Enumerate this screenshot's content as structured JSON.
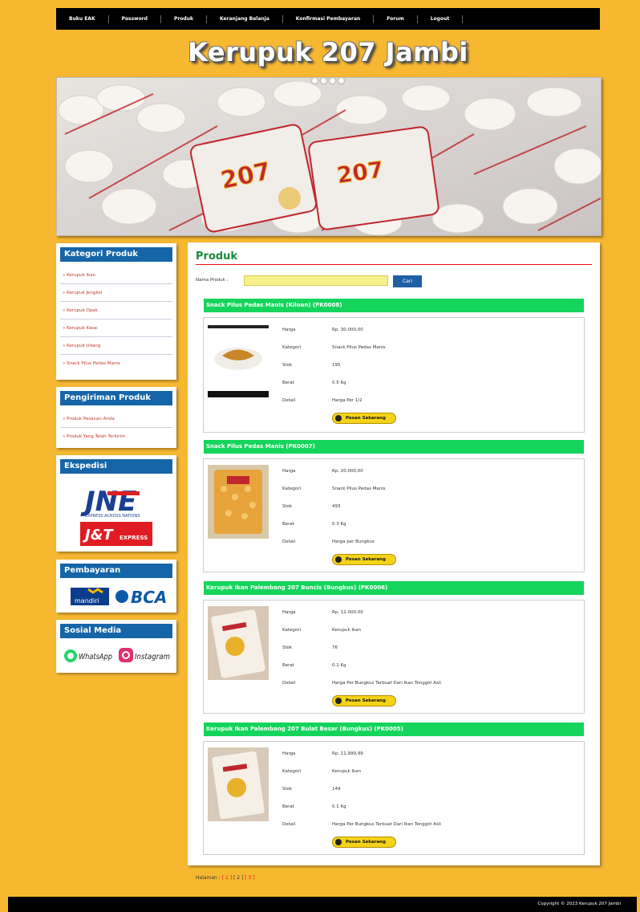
{
  "nav": [
    "Buku EAK",
    "Password",
    "Produk",
    "Keranjang Belanja",
    "Konfirmasi Pembayaran",
    "Forum",
    "Logout"
  ],
  "site_title": "Kerupuk 207 Jambi",
  "sidebar": {
    "categories_title": "Kategori Produk",
    "categories": [
      "» Kerupuk Ikan",
      "» Kerupuk Jengkol",
      "» Kerupuk Opak",
      "» Kerupuk Kwac",
      "» Kerupuk Udang",
      "» Snack Pilus Pedas Manis"
    ],
    "shipping_title": "Pengiriman Produk",
    "shipping": [
      "» Produk Pesanan Anda",
      "» Produk Yang Telah Terkirim"
    ],
    "expedition_title": "Ekspedisi",
    "payment_title": "Pembayaran",
    "social_title": "Sosial Media",
    "logos": {
      "jne": "JNE",
      "jne_sub": "EXPRESS ACROSS NATIONS",
      "jnt": "J&T",
      "jnt_sub": "EXPRESS",
      "mandiri": "mandiri",
      "bca": "BCA",
      "whatsapp": "WhatsApp",
      "instagram": "Instagram"
    }
  },
  "main": {
    "title": "Produk",
    "search_label": "Nama Produk :",
    "search_value": "",
    "search_button": "Cari",
    "spec_labels": {
      "price": "Harga",
      "category": "Kategori",
      "stock": "Stok",
      "weight": "Berat",
      "detail": "Detail"
    },
    "order_label": "Pesan Sekarang",
    "products": [
      {
        "name": "Snack Pilus Pedas Manis (Kiloan) (PK0008)",
        "price": "Rp. 30.000,00",
        "category": "Snack Pilus Pedas Manis",
        "stock": "195",
        "weight": "0.5 Kg",
        "detail": "Harga Per 1/2"
      },
      {
        "name": "Snack Pilus Pedas Manis (PK0007)",
        "price": "Rp. 20.000,00",
        "category": "Snack Pilus Pedas Manis",
        "stock": "493",
        "weight": "0.3 Kg",
        "detail": "Harga per Bungkus"
      },
      {
        "name": "Kerupuk Ikan Palembang 207 Buncis (Bungkus) (PK0006)",
        "price": "Rp. 12.000,00",
        "category": "Kerupuk Ikan",
        "stock": "76",
        "weight": "0.1 Kg",
        "detail": "Harga Per Bungkus Terbuat Dari Ikan Tenggiri Asli"
      },
      {
        "name": "Kerupuk Ikan Palembang 207 Bulat Besar (Bungkus) (PK0005)",
        "price": "Rp. 11.999,99",
        "category": "Kerupuk Ikan",
        "stock": "149",
        "weight": "0.1 Kg",
        "detail": "Harga Per Bungkus Terbuat Dari Ikan Tenggiri Asli"
      }
    ],
    "paging": {
      "label": "Halaman :",
      "pages": [
        "1",
        "2",
        "3"
      ],
      "current": "2"
    }
  },
  "footer": "Copyright © 2023 Kerupuk 207 Jambi"
}
